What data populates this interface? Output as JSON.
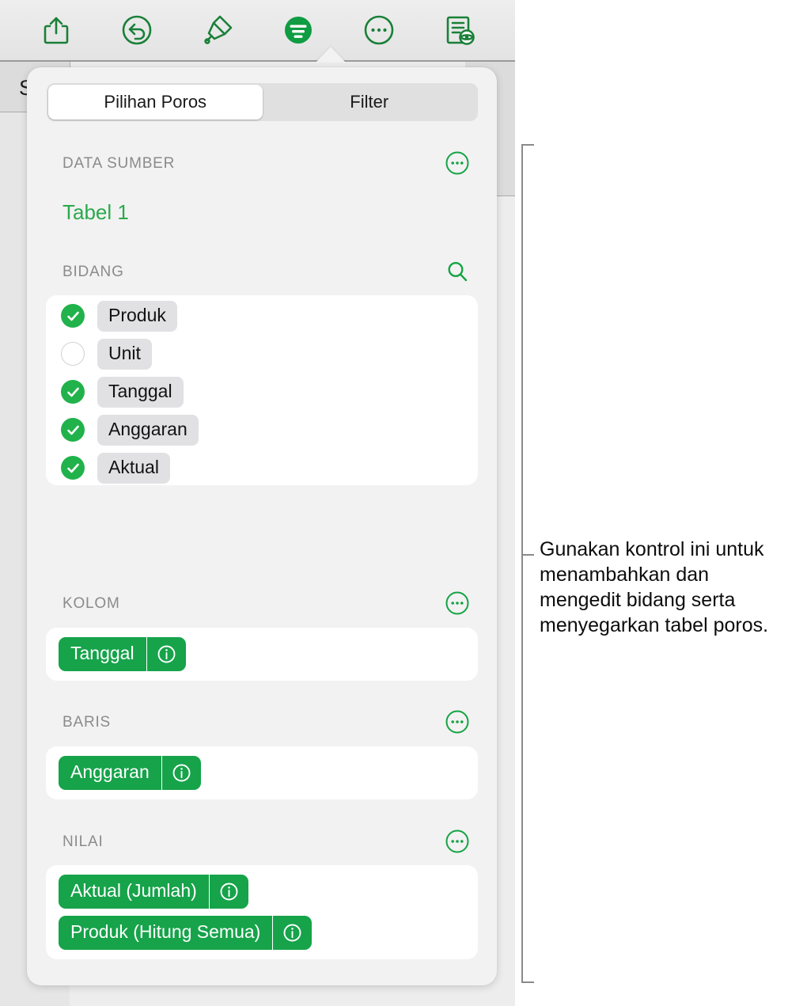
{
  "toolbar": {
    "buttons": [
      {
        "name": "share-icon",
        "label": "Bagikan"
      },
      {
        "name": "undo-icon",
        "label": "Urungkan"
      },
      {
        "name": "paintbrush-format-icon",
        "label": "Format"
      },
      {
        "name": "pivot-filter-icon",
        "label": "Atur Tabel Poros"
      },
      {
        "name": "more-ellipsis-icon",
        "label": "Lainnya"
      },
      {
        "name": "document-preview-icon",
        "label": "Tampilan Dokumen"
      }
    ],
    "active_index": 3
  },
  "background": {
    "hidden_cell_text": "S"
  },
  "popover": {
    "tabs": [
      {
        "label": "Pilihan Poros",
        "active": true
      },
      {
        "label": "Filter",
        "active": false
      }
    ],
    "source_section": {
      "title": "DATA SUMBER",
      "action_icon": "more-ellipsis-icon",
      "table_name": "Tabel 1"
    },
    "fields_section": {
      "title": "BIDANG",
      "action_icon": "search-icon",
      "fields": [
        {
          "label": "Produk",
          "checked": true
        },
        {
          "label": "Unit",
          "checked": false
        },
        {
          "label": "Tanggal",
          "checked": true
        },
        {
          "label": "Anggaran",
          "checked": true
        },
        {
          "label": "Aktual",
          "checked": true
        }
      ]
    },
    "columns_section": {
      "title": "KOLOM",
      "action_icon": "more-ellipsis-icon",
      "tokens": [
        {
          "label": "Tanggal",
          "info_icon": "info-icon"
        }
      ]
    },
    "rows_section": {
      "title": "BARIS",
      "action_icon": "more-ellipsis-icon",
      "tokens": [
        {
          "label": "Anggaran",
          "info_icon": "info-icon"
        }
      ]
    },
    "values_section": {
      "title": "NILAI",
      "action_icon": "more-ellipsis-icon",
      "tokens": [
        {
          "label": "Aktual (Jumlah)",
          "info_icon": "info-icon"
        },
        {
          "label": "Produk (Hitung Semua)",
          "info_icon": "info-icon"
        }
      ]
    }
  },
  "callout": {
    "text": "Gunakan kontrol ini untuk menambahkan dan mengedit bidang serta menyegarkan tabel poros."
  },
  "colors": {
    "accent_green": "#16a34a",
    "check_green": "#21b24b",
    "source_link_green": "#2aaa4c",
    "section_label_gray": "#8b8b8b",
    "popover_bg": "#f2f2f2",
    "card_bg": "#ffffff",
    "chip_gray": "#e1e1e4"
  }
}
